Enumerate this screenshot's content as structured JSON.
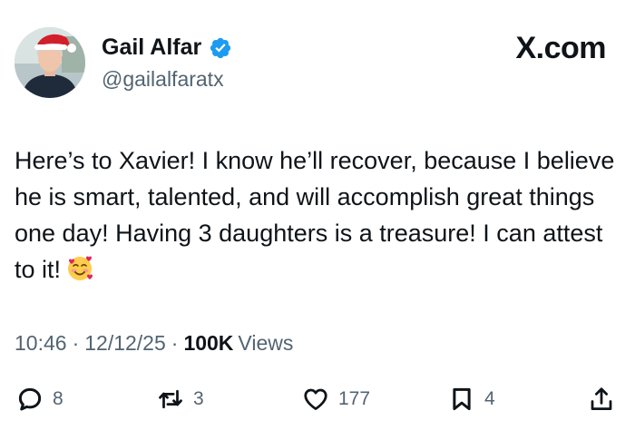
{
  "author": {
    "display_name": "Gail Alfar",
    "handle": "@gailalfaratx",
    "verified_icon": "verified-badge-icon",
    "avatar_icon": "avatar-photo"
  },
  "brand": {
    "label": "X.com"
  },
  "tweet": {
    "text": "Here’s to Xavier! I know he’ll recover, because I believe he is smart, talented, and will accomplish great things one day! Having 3 daughters is a treasure! I can attest to it!",
    "emoji": "smiling-face-with-hearts-emoji"
  },
  "meta": {
    "time": "10:46",
    "date": "12/12/25",
    "separator": "·",
    "views_count": "100K",
    "views_label": "Views"
  },
  "actions": {
    "replies": "8",
    "reposts": "3",
    "likes": "177",
    "bookmarks": "4"
  },
  "colors": {
    "text": "#0f1419",
    "secondary": "#536471",
    "verified": "#1d9bf0"
  }
}
